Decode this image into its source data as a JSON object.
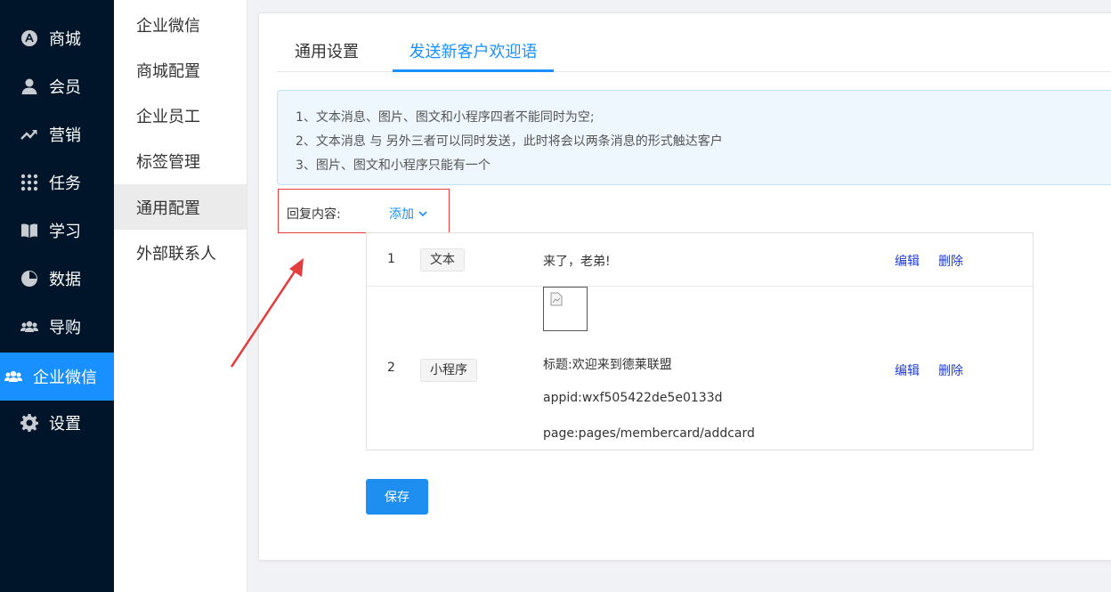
{
  "nav": {
    "items": [
      {
        "label": "商城",
        "icon": "store-icon"
      },
      {
        "label": "会员",
        "icon": "user-icon"
      },
      {
        "label": "营销",
        "icon": "trend-icon"
      },
      {
        "label": "任务",
        "icon": "grid-icon"
      },
      {
        "label": "学习",
        "icon": "book-icon"
      },
      {
        "label": "数据",
        "icon": "pie-icon"
      },
      {
        "label": "导购",
        "icon": "group-icon"
      },
      {
        "label": "企业微信",
        "icon": "team-icon",
        "active": true
      },
      {
        "label": "设置",
        "icon": "gear-icon"
      }
    ]
  },
  "submenu": {
    "items": [
      "企业微信",
      "商城配置",
      "企业员工",
      "标签管理",
      "通用配置",
      "外部联系人"
    ],
    "active": "通用配置"
  },
  "tabs": {
    "general": "通用设置",
    "welcome": "发送新客户欢迎语"
  },
  "notice": {
    "line1": "1、文本消息、图片、图文和小程序四者不能同时为空;",
    "line2": "2、文本消息 与 另外三者可以同时发送，此时将会以两条消息的形式触达客户",
    "line3": "3、图片、图文和小程序只能有一个"
  },
  "reply": {
    "label": "回复内容:",
    "add": "添加"
  },
  "rows": [
    {
      "index": "1",
      "type": "文本",
      "text": "来了，老弟!",
      "edit": "编辑",
      "delete": "删除"
    },
    {
      "index": "2",
      "type": "小程序",
      "title": "标题:欢迎来到德莱联盟",
      "appid": "appid:wxf505422de5e0133d",
      "page": "page:pages/membercard/addcard",
      "edit": "编辑",
      "delete": "删除"
    }
  ],
  "save": "保存",
  "colors": {
    "primary": "#1890ff",
    "nav_bg": "#001529",
    "highlight": "#e43d3d"
  }
}
